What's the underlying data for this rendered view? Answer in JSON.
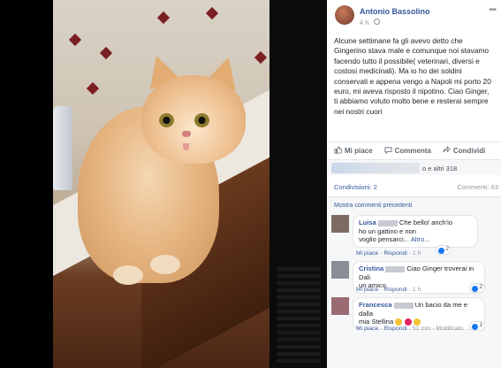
{
  "post": {
    "author": "Antonio Bassolino",
    "time": "4 h",
    "text": "Alcune settimane fa gli avevo detto che Gingerino stava male e comunque noi stavamo facendo tutto il possibile( veterinari, diversi e costosi medicinali). Ma io ho dei soldini conservati e appena vengo a Napoli mi porto 20 euro, mi aveva risposto il nipotino. Ciao Ginger, ti abbiamo voluto molto bene e resterai sempre nei nostri cuori"
  },
  "actions": {
    "like": "Mi piace",
    "comment": "Commenta",
    "share": "Condividi"
  },
  "reactions": {
    "others": "o e altri 318"
  },
  "stats": {
    "shares": "Condivisioni: 2",
    "comments": "Commenti: 63"
  },
  "comments_section": {
    "show_previous": "Mostra commenti precedenti",
    "items": [
      {
        "name": "Luisa",
        "text_a": "Che bello! anch'io",
        "text_b": "ho un gattino e non",
        "text_c": "voglio pensarci...",
        "more": "Altro...",
        "likes": "2",
        "like_label": "Mi piace",
        "reply": "Rispondi",
        "time": "1 h",
        "edited": ""
      },
      {
        "name": "Cristina",
        "text_a": "Ciao Ginger troverai in Dali",
        "text_b": "un amico",
        "text_c": "",
        "more": "",
        "likes": "2",
        "like_label": "Mi piace",
        "reply": "Rispondi",
        "time": "1 h",
        "edited": ""
      },
      {
        "name": "Francesca",
        "text_a": "Un bacio da me e dalla",
        "text_b": "mia Stellina",
        "text_c": "",
        "more": "",
        "likes": "1",
        "like_label": "Mi piace",
        "reply": "Rispondi",
        "time": "51 min",
        "edited": "Modificato"
      }
    ]
  },
  "colors": {
    "link": "#365899",
    "meta": "#90949c",
    "like_blue": "#1877f2"
  },
  "icons": {
    "globe": "globe-icon",
    "more": "more-options-icon",
    "like": "thumbs-up-icon",
    "comment": "speech-bubble-icon",
    "share": "share-arrow-icon"
  }
}
